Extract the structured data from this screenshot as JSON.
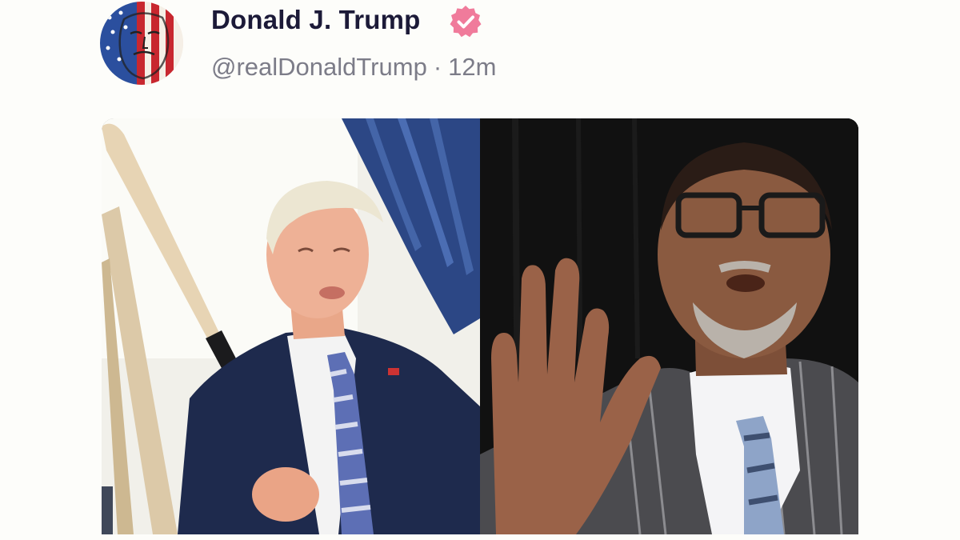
{
  "post": {
    "author": {
      "display_name": "Donald J. Trump",
      "handle": "@realDonaldTrump",
      "separator": "·",
      "timestamp": "12m",
      "verified": true,
      "verified_badge_color": "#f07b9b",
      "avatar_icon": "flag-portrait-avatar"
    },
    "media": {
      "layout": "two-photo-grid",
      "photos": [
        {
          "description_icon": "man-with-baseball-bat-photo"
        },
        {
          "description_icon": "man-with-raised-hand-photo"
        }
      ]
    }
  },
  "colors": {
    "background": "#fdfdfa",
    "name_text": "#1c1a38",
    "meta_text": "#7c7c88"
  }
}
